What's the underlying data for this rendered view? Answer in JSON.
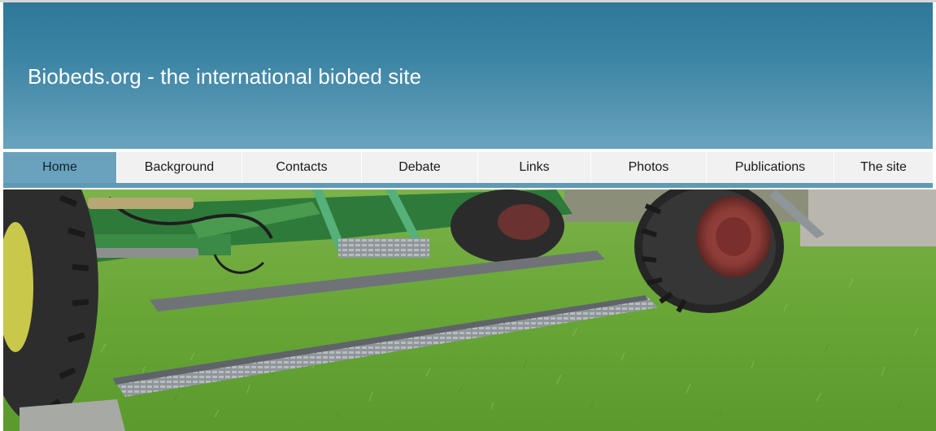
{
  "site": {
    "title": "Biobeds.org - the international biobed site"
  },
  "nav": {
    "items": [
      {
        "label": "Home",
        "active": true
      },
      {
        "label": "Background",
        "active": false
      },
      {
        "label": "Contacts",
        "active": false
      },
      {
        "label": "Debate",
        "active": false
      },
      {
        "label": "Links",
        "active": false
      },
      {
        "label": "Photos",
        "active": false
      },
      {
        "label": "Publications",
        "active": false
      },
      {
        "label": "The site",
        "active": false
      }
    ]
  },
  "colors": {
    "header_top": "#2f7899",
    "header_bottom": "#6aa3bd",
    "nav_active": "#6aa1bc",
    "nav_bg": "#f1f1f1",
    "grass": "#6fae3c"
  },
  "hero": {
    "subject": "tractor-wheels-on-grass-photo"
  }
}
